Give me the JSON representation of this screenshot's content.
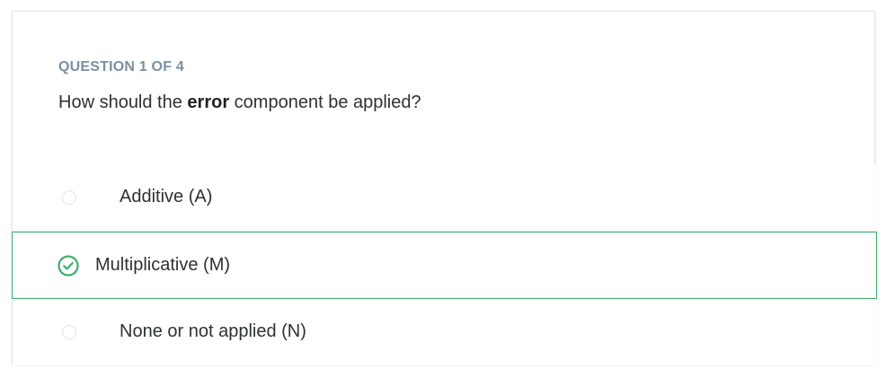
{
  "quiz": {
    "counter": "QUESTION 1 OF 4",
    "question_prefix": "How should the ",
    "question_bold": "error",
    "question_suffix": " component be applied?",
    "options": [
      {
        "label": "Additive (A)",
        "selected": false
      },
      {
        "label": "Multiplicative (M)",
        "selected": true
      },
      {
        "label": "None or not applied (N)",
        "selected": false
      }
    ]
  },
  "colors": {
    "accent": "#3fae6c",
    "counter": "#7a8fa2",
    "text": "#2e3133",
    "border": "#e4e7ea"
  },
  "icons": {
    "selected": "check-circle-icon",
    "unselected": "radio-empty-icon"
  }
}
